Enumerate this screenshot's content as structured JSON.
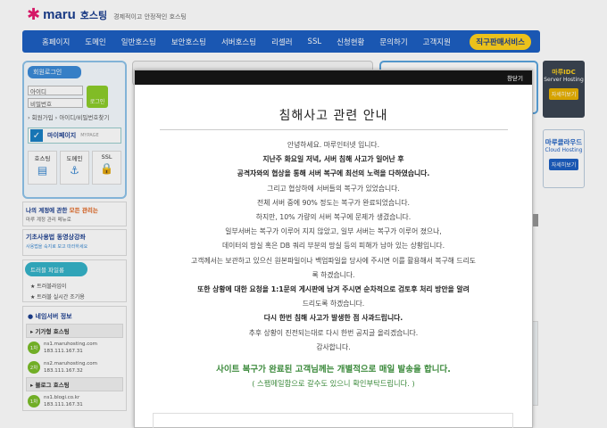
{
  "header": {
    "logo_mark": "✱",
    "logo_text": "maru",
    "logo_sub": "호스팅",
    "logo_tag": "경제적이고 안정적인 호스팅"
  },
  "nav": {
    "items": [
      "홈페이지",
      "도메인",
      "일반호스팅",
      "보안호스팅",
      "서버호스팅",
      "리셀러",
      "SSL",
      "신청현황",
      "문의하기",
      "고객지원"
    ],
    "cta": "직구판매서비스"
  },
  "sidebar": {
    "login_title": "회원로그인",
    "id_placeholder": "아이디",
    "pw_placeholder": "비밀번호",
    "login_button": "로그인",
    "links": "› 회원가입  › 아이디/비밀번호찾기",
    "mypage": "마이페이지",
    "mypage_en": "MYPAGE",
    "quick": [
      "호스팅",
      "도메인",
      "SSL"
    ],
    "banner1_title_prefix": "나의 계정에 관한 ",
    "banner1_title_em": "모든 관리는",
    "banner1_sub": "마루 계정 관리 메뉴로",
    "banner2_title": "기초사용법 동영상강좌",
    "banner2_sub": "사용법을 숙지로 보고 따라하세요",
    "trouble_title": "트러블 파일롱",
    "trouble_items": [
      "트러블라임이",
      "트러블 실시간 조기용"
    ],
    "ns_title": "네임서버 정보",
    "ns_sub1": "기가형 호스팅",
    "ns_entries": [
      {
        "badge": "1차",
        "host": "ns1.maruhosting.com",
        "ip": "183.111.167.31"
      },
      {
        "badge": "2차",
        "host": "ns2.maruhosting.com",
        "ip": "183.111.167.32"
      }
    ],
    "ns_sub2": "블로그 호스팅",
    "ns_entries2": [
      {
        "badge": "1차",
        "host": "ns1.blogi.co.kr",
        "ip": "183.111.167.31"
      }
    ]
  },
  "right_banners": {
    "b1_title": "마루IDC",
    "b1_sub": "Server Hosting",
    "b1_btn": "자세히보기",
    "b2_title": "마루클라우드",
    "b2_sub": "Cloud Hosting",
    "b2_btn": "자세히보기"
  },
  "modal": {
    "close": "창닫기",
    "title": "침해사고 관련 안내",
    "lines": [
      "안녕하세요. 마루인터넷 입니다.",
      "지난주 화요일 저녁, 서버 침해 사고가 일어난 후",
      "공격자와의 협상을 통해 서버 복구에 최선의 노력을 다하였습니다.",
      "그리고 협상하에 서버들의 복구가 있었습니다.",
      "전체 서버 중에 90% 정도는 복구가 완료되었습니다.",
      "하지만, 10% 가량의 서버 복구에 문제가 생겼습니다.",
      "일부서버는 복구가 이루어 지지 않았고, 일부 서버는 복구가 이루어 졌으나,",
      "데이터의 망실 혹은 DB 쿼리 부분의 망실 등의 피해가 남아 있는 상황입니다.",
      "고객께서는 보관하고 있으신 원본파일이나 백업파일을 당사에 주시면 이를 활용해서 복구해 드리도",
      "록 하겠습니다.",
      "또한 상황에 대한 요청을 1:1문의 게시판에 남겨 주시면 순차적으로 검토후 처리 방안을 알려",
      "드리도록 하겠습니다.",
      "다시 한번 침해 사고가 발생한 점 사과드립니다.",
      "추후 상황이 진전되는대로 다시 한번 공지글 올리겠습니다.",
      "감사합니다."
    ],
    "notice": "사이트 복구가 완료된 고객님께는 개별적으로 매일 발송을 합니다.",
    "notice2": "( 스팸메일함으로 갈수도 있으니 확인부탁드립니다. )"
  }
}
